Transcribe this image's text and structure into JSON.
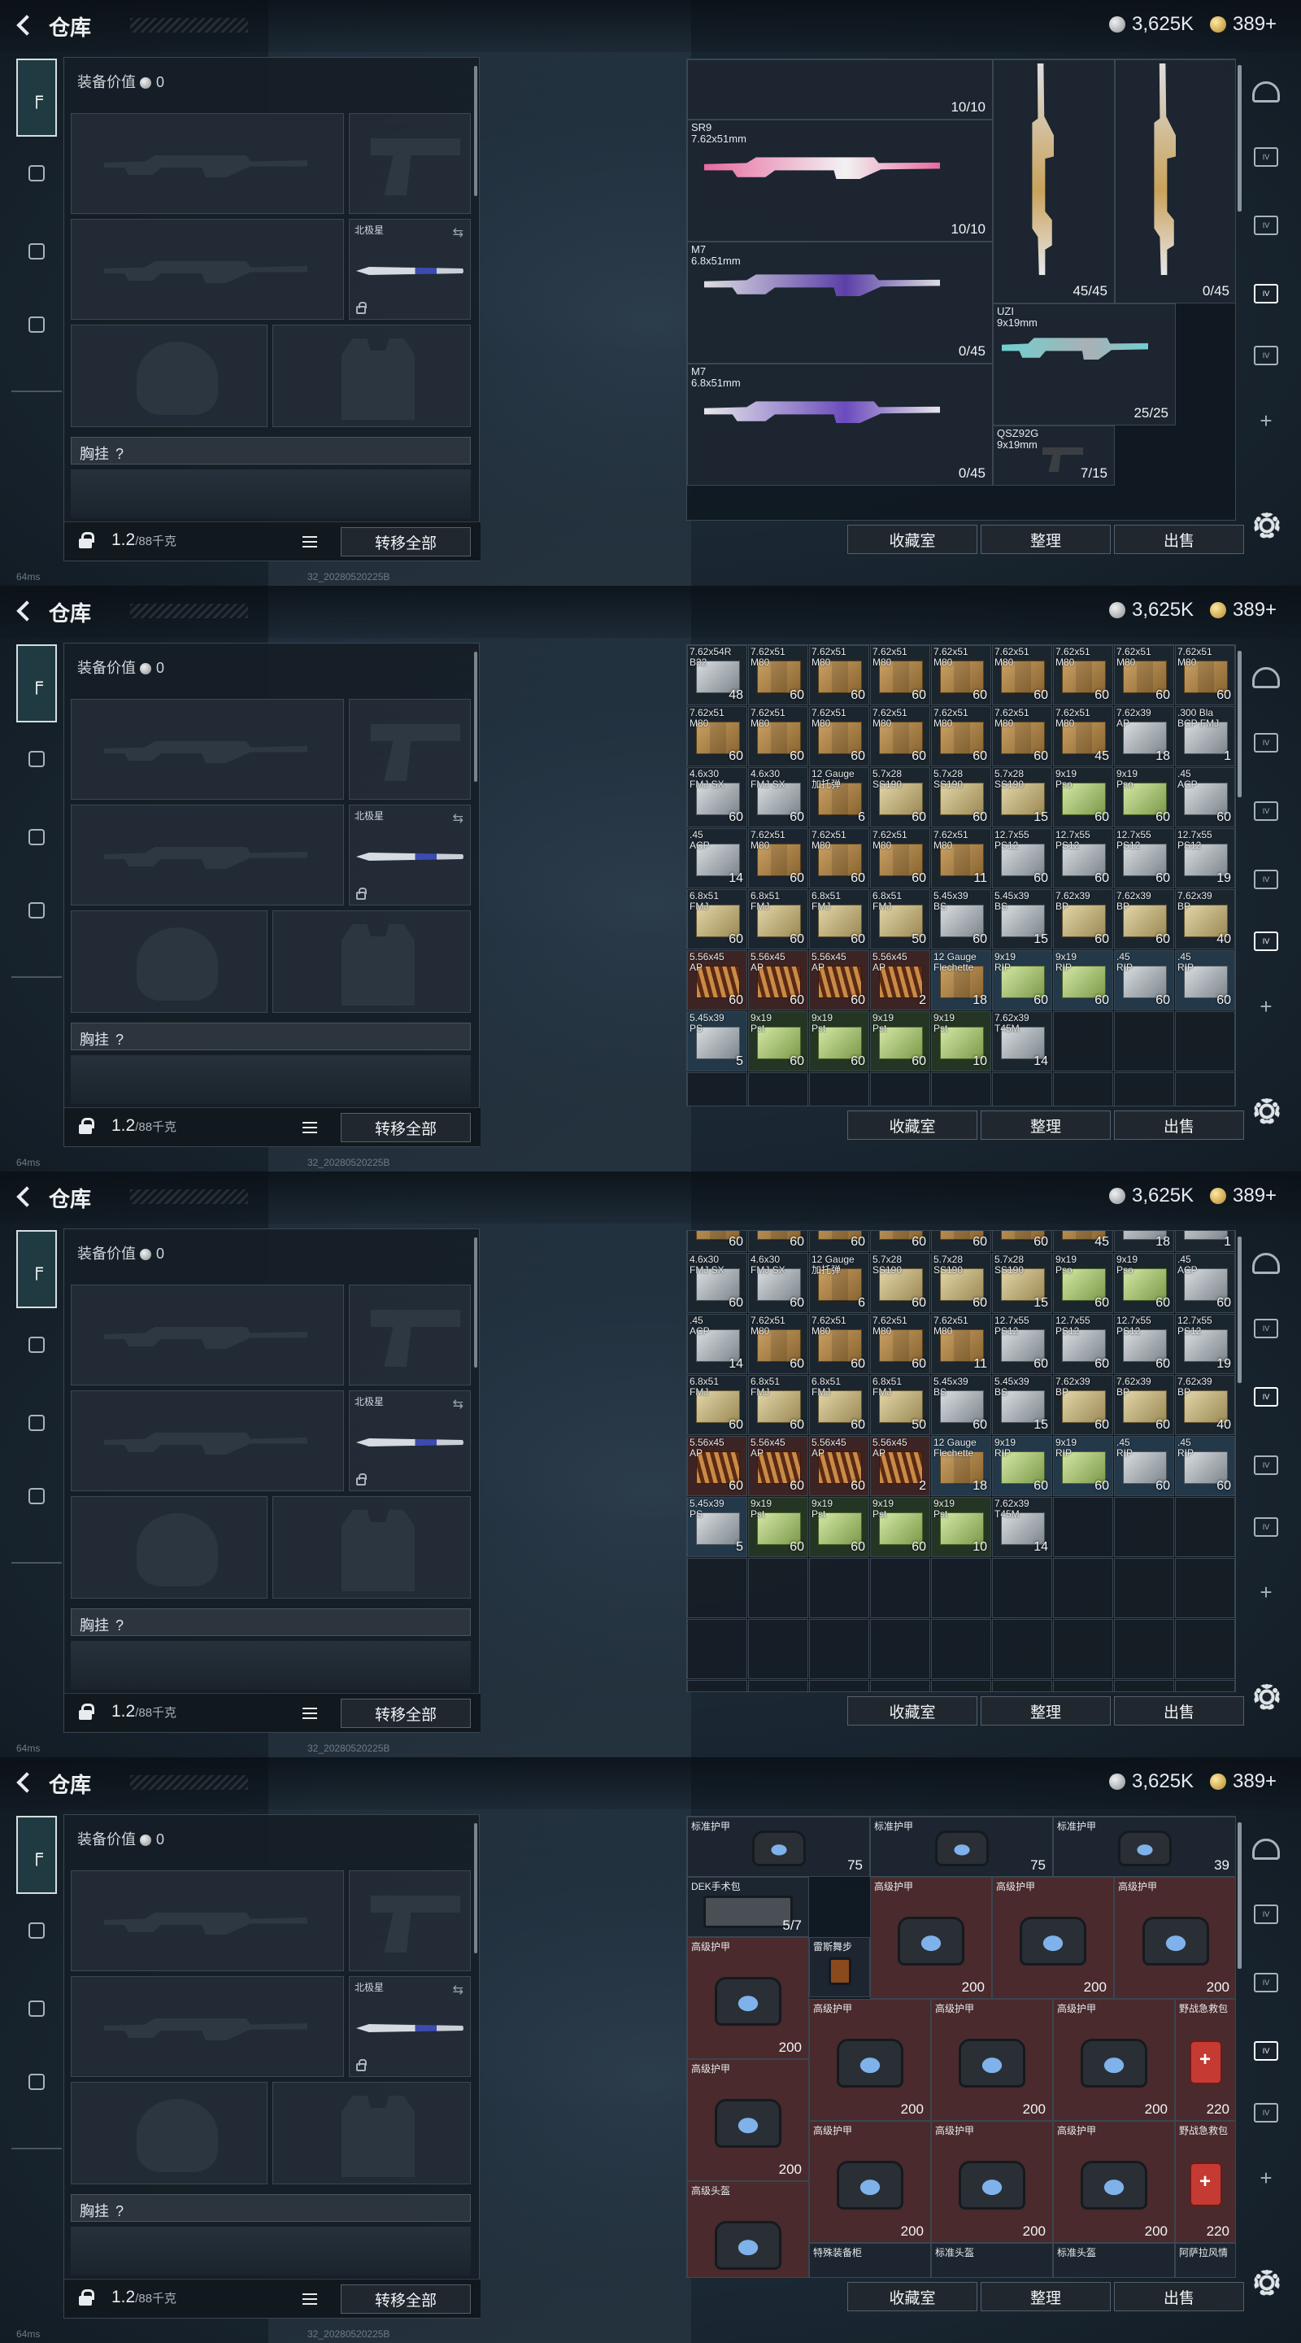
{
  "window": {
    "title": "仓库",
    "currency_silver": "3,625K",
    "currency_gold": "389+"
  },
  "left": {
    "equip_value_label": "装备价值",
    "equip_value": "0",
    "knife_name": "北极星",
    "chest_label": "胸挂",
    "chest_q": "?",
    "weight": "1.2",
    "weight_max": "/88千克",
    "move_all": "转移全部"
  },
  "status": {
    "ping": "64ms",
    "build": "32_20280520225B"
  },
  "actions": {
    "vault": "收藏室",
    "sort": "整理",
    "sell": "出售"
  },
  "frame1": {
    "weapons": [
      {
        "name": "",
        "count": "10/10"
      },
      {
        "name": "SR9\n7.62x51mm",
        "count": "10/10"
      },
      {
        "name": "M7\n6.8x51mm",
        "count": "0/45"
      },
      {
        "name": "M7\n6.8x51mm",
        "count": "0/45"
      },
      {
        "name": "",
        "count": "45/45"
      },
      {
        "name": "",
        "count": "0/45"
      },
      {
        "name": "UZI\n9x19mm",
        "count": "25/25"
      },
      {
        "name": "QSZ92G\n9x19mm",
        "count": "7/15"
      }
    ]
  },
  "ammo_rows": [
    [
      [
        "7.62x54R\nB32",
        "48",
        "gray",
        ""
      ],
      [
        "7.62x51\nM80",
        "60",
        "brown",
        ""
      ],
      [
        "7.62x51\nM80",
        "60",
        "brown",
        ""
      ],
      [
        "7.62x51\nM80",
        "60",
        "brown",
        ""
      ],
      [
        "7.62x51\nM80",
        "60",
        "brown",
        ""
      ],
      [
        "7.62x51\nM80",
        "60",
        "brown",
        ""
      ],
      [
        "7.62x51\nM80",
        "60",
        "brown",
        ""
      ],
      [
        "7.62x51\nM80",
        "60",
        "brown",
        ""
      ],
      [
        "7.62x51\nM80",
        "60",
        "brown",
        ""
      ]
    ],
    [
      [
        "7.62x51\nM80",
        "60",
        "brown",
        ""
      ],
      [
        "7.62x51\nM80",
        "60",
        "brown",
        ""
      ],
      [
        "7.62x51\nM80",
        "60",
        "brown",
        ""
      ],
      [
        "7.62x51\nM80",
        "60",
        "brown",
        ""
      ],
      [
        "7.62x51\nM80",
        "60",
        "brown",
        ""
      ],
      [
        "7.62x51\nM80",
        "60",
        "brown",
        ""
      ],
      [
        "7.62x51\nM80",
        "45",
        "brown",
        ""
      ],
      [
        "7.62x39\nAP",
        "18",
        "gray",
        ""
      ],
      [
        ".300 Bla\nBCP FMJ",
        "1",
        "gray",
        ""
      ]
    ],
    [
      [
        "4.6x30\nFMJ SX",
        "60",
        "gray",
        ""
      ],
      [
        "4.6x30\nFMJ SX",
        "60",
        "gray",
        ""
      ],
      [
        "12 Gauge\n加托弹",
        "6",
        "brown",
        ""
      ],
      [
        "5.7x28\nSS190",
        "60",
        "tan",
        ""
      ],
      [
        "5.7x28\nSS190",
        "60",
        "tan",
        ""
      ],
      [
        "5.7x28\nSS190",
        "15",
        "tan",
        ""
      ],
      [
        "9x19\nPso",
        "60",
        "green",
        ""
      ],
      [
        "9x19\nPso",
        "60",
        "green",
        ""
      ],
      [
        ".45\nACP",
        "60",
        "gray",
        ""
      ]
    ],
    [
      [
        ".45\nACP",
        "14",
        "gray",
        ""
      ],
      [
        "7.62x51\nM80",
        "60",
        "brown",
        ""
      ],
      [
        "7.62x51\nM80",
        "60",
        "brown",
        ""
      ],
      [
        "7.62x51\nM80",
        "60",
        "brown",
        ""
      ],
      [
        "7.62x51\nM80",
        "11",
        "brown",
        ""
      ],
      [
        "12.7x55\nPS12",
        "60",
        "gray",
        ""
      ],
      [
        "12.7x55\nPS12",
        "60",
        "gray",
        ""
      ],
      [
        "12.7x55\nPS12",
        "60",
        "gray",
        ""
      ],
      [
        "12.7x55\nPS12",
        "19",
        "gray",
        ""
      ]
    ],
    [
      [
        "6.8x51\nFMJ",
        "60",
        "tan",
        ""
      ],
      [
        "6.8x51\nFMJ",
        "60",
        "tan",
        ""
      ],
      [
        "6.8x51\nFMJ",
        "60",
        "tan",
        ""
      ],
      [
        "6.8x51\nFMJ",
        "50",
        "tan",
        ""
      ],
      [
        "5.45x39\nBS",
        "60",
        "gray",
        ""
      ],
      [
        "5.45x39\nBS",
        "15",
        "gray",
        ""
      ],
      [
        "7.62x39\nBP",
        "60",
        "tan",
        ""
      ],
      [
        "7.62x39\nBP",
        "60",
        "tan",
        ""
      ],
      [
        "7.62x39\nBP",
        "40",
        "tan",
        ""
      ]
    ],
    [
      [
        "5.56x45\nAP",
        "60",
        "red",
        "rd"
      ],
      [
        "5.56x45\nAP",
        "60",
        "red",
        "rd"
      ],
      [
        "5.56x45\nAP",
        "60",
        "red",
        "rd"
      ],
      [
        "5.56x45\nAP",
        "2",
        "red",
        "rd"
      ],
      [
        "12 Gauge\nFlechette",
        "18",
        "brown",
        "bl"
      ],
      [
        "9x19\nRIP",
        "60",
        "green",
        "bl"
      ],
      [
        "9x19\nRIP",
        "60",
        "green",
        "bl"
      ],
      [
        ".45\nRIP",
        "60",
        "gray",
        "bl"
      ],
      [
        ".45\nRIP",
        "60",
        "gray",
        "bl"
      ]
    ],
    [
      [
        "5.45x39\nPS",
        "5",
        "gray",
        "bl"
      ],
      [
        "9x19\nPst",
        "60",
        "green",
        "gr"
      ],
      [
        "9x19\nPst",
        "60",
        "green",
        "gr"
      ],
      [
        "9x19\nPst",
        "60",
        "green",
        "gr"
      ],
      [
        "9x19\nPst",
        "10",
        "green",
        "gr"
      ],
      [
        "7.62x39\nT45M",
        "14",
        "gray",
        ""
      ]
    ]
  ],
  "frame4": {
    "items": [
      {
        "name": "标准护甲",
        "count": "75"
      },
      {
        "name": "标准护甲",
        "count": "75"
      },
      {
        "name": "标准护甲",
        "count": "39"
      },
      {
        "name": "DEK手术包",
        "count": "5/7"
      },
      {
        "name": "高级护甲",
        "count": "200"
      },
      {
        "name": "高级护甲",
        "count": "200"
      },
      {
        "name": "高级护甲",
        "count": "200"
      },
      {
        "name": "高级护甲",
        "count": "200"
      },
      {
        "name": "雷斯舞步",
        "count": ""
      },
      {
        "name": "高级护甲",
        "count": "200"
      },
      {
        "name": "高级护甲",
        "count": "200"
      },
      {
        "name": "高级护甲",
        "count": "200"
      },
      {
        "name": "野战急救包",
        "count": "220"
      },
      {
        "name": "高级护甲",
        "count": "200"
      },
      {
        "name": "高级护甲",
        "count": "200"
      },
      {
        "name": "高级护甲",
        "count": "200"
      },
      {
        "name": "高级护甲",
        "count": "200"
      },
      {
        "name": "野战急救包",
        "count": "220"
      },
      {
        "name": "高级头盔",
        "count": ""
      },
      {
        "name": "特殊装备柜",
        "count": ""
      },
      {
        "name": "标准头盔",
        "count": ""
      },
      {
        "name": "标准头盔",
        "count": ""
      },
      {
        "name": "阿萨拉风情",
        "count": ""
      }
    ]
  },
  "side_nav": {
    "labels": [
      "IV",
      "IV",
      "IV",
      "IV",
      "IV"
    ]
  }
}
